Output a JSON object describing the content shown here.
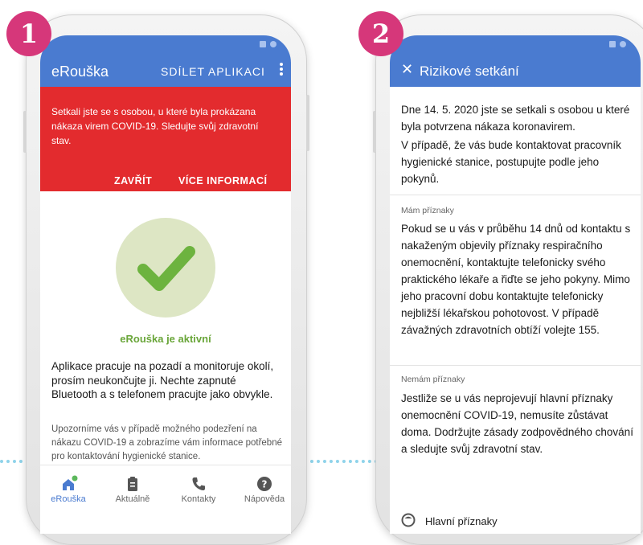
{
  "badges": {
    "first": "1",
    "second": "2"
  },
  "screen1": {
    "app_title": "eRouška",
    "share_button": "SDÍLET APLIKACI",
    "alert": {
      "text": "Setkali jste se s osobou, u které byla prokázana nákaza virem COVID-19. Sledujte svůj zdravotní stav.",
      "close_button": "ZAVŘÍT",
      "more_button": "VÍCE INFORMACÍ"
    },
    "status": "eRouška je aktivní",
    "description": "Aplikace pracuje na pozadí a monitoruje okolí, prosím neukončujte ji. Nechte zapnuté Bluetooth a s telefonem pracujte jako obvykle.",
    "description_secondary": "Upozorníme vás v případě možného podezření na nákazu COVID-19 a zobrazíme vám informace potřebné pro kontaktování hygienické stanice.",
    "nav": [
      {
        "label": "eRouška",
        "icon": "home-icon"
      },
      {
        "label": "Aktuálně",
        "icon": "clipboard-icon"
      },
      {
        "label": "Kontakty",
        "icon": "phone-icon"
      },
      {
        "label": "Nápověda",
        "icon": "help-icon"
      }
    ]
  },
  "screen2": {
    "title": "Rizikové setkání",
    "intro_1": "Dne 14. 5. 2020 jste se setkali s osobou u které byla potvrzena nákaza koronavirem.",
    "intro_2": "V případě, že vás bude kontaktovat pracovník hygienické stanice, postupujte podle jeho pokynů.",
    "section_symptoms": {
      "label": "Mám příznaky",
      "text": "Pokud se u vás v průběhu 14 dnů od kontaktu s nakaženým objevily příznaky respiračního onemocnění, kontaktujte telefonicky svého praktického lékaře a řiďte se jeho pokyny. Mimo jeho pracovní dobu kontaktujte telefonicky nejbližší lékařskou pohotovost. V případě závažných zdravotních obtíží volejte 155."
    },
    "section_no_symptoms": {
      "label": "Nemám příznaky",
      "text": "Jestliže se u vás neprojevují hlavní příznaky onemocnění COVID-19, nemusíte zůstávat doma. Dodržujte zásady zodpovědného chování a sledujte svůj zdravotní stav."
    },
    "main_symptoms": "Hlavní příznaky"
  },
  "colors": {
    "app_bar": "#4a7bd0",
    "alert": "#e32b2e",
    "badge": "#d6377a",
    "active_green": "#6aa63a",
    "check_green": "#6db33f",
    "nav_dot": "#5cb85c"
  }
}
